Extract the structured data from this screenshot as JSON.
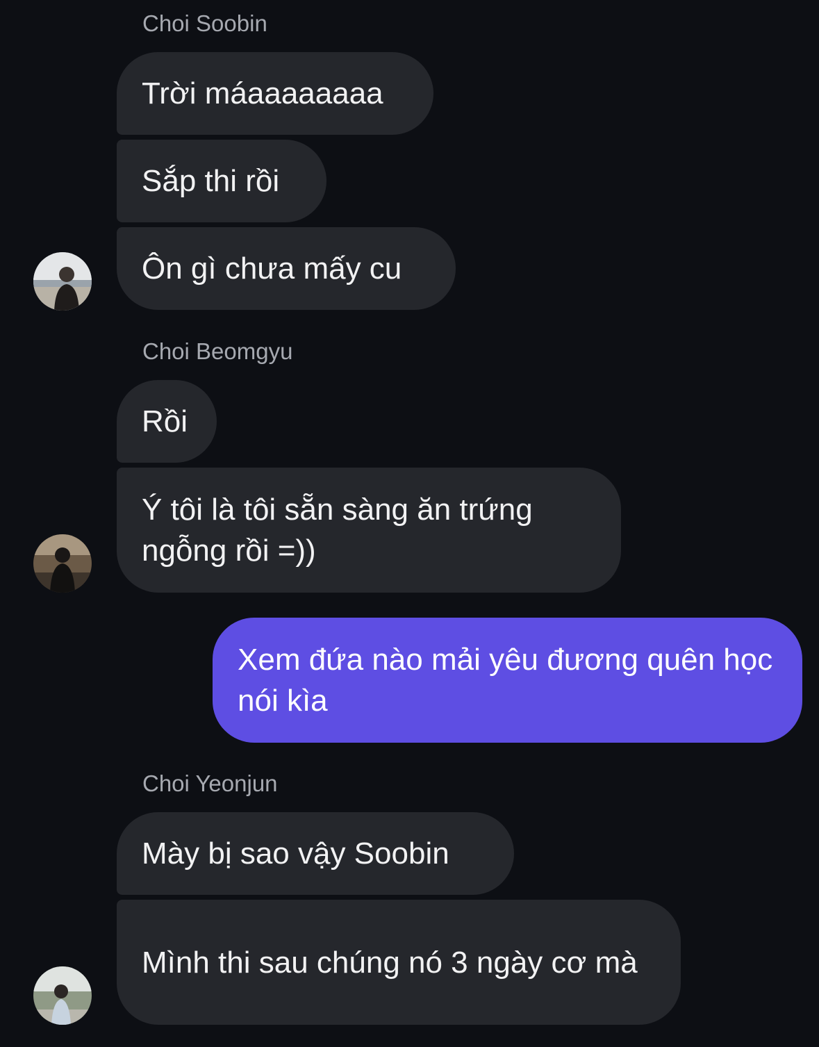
{
  "conversation": {
    "groups": [
      {
        "sender": "Choi Soobin",
        "messages": [
          "Trời máaaaaaaaa",
          "Sắp thi rồi",
          "Ôn gì chưa mấy cu"
        ]
      },
      {
        "sender": "Choi Beomgyu",
        "messages": [
          "Rồi",
          "Ý tôi là tôi sẵn sàng ăn trứng ngỗng rồi =))"
        ]
      },
      {
        "sender": "",
        "outgoing": true,
        "messages": [
          "Xem đứa nào mải yêu đương quên học nói kìa"
        ]
      },
      {
        "sender": "Choi Yeonjun",
        "messages": [
          "Mày bị sao vậy Soobin",
          "Mình thi sau chúng nó 3 ngày cơ mà"
        ]
      }
    ]
  },
  "colors": {
    "background": "#0d0f14",
    "incoming_bubble": "#25272c",
    "outgoing_bubble": "#5e4ee3",
    "sender_name": "#a6a9b0"
  }
}
